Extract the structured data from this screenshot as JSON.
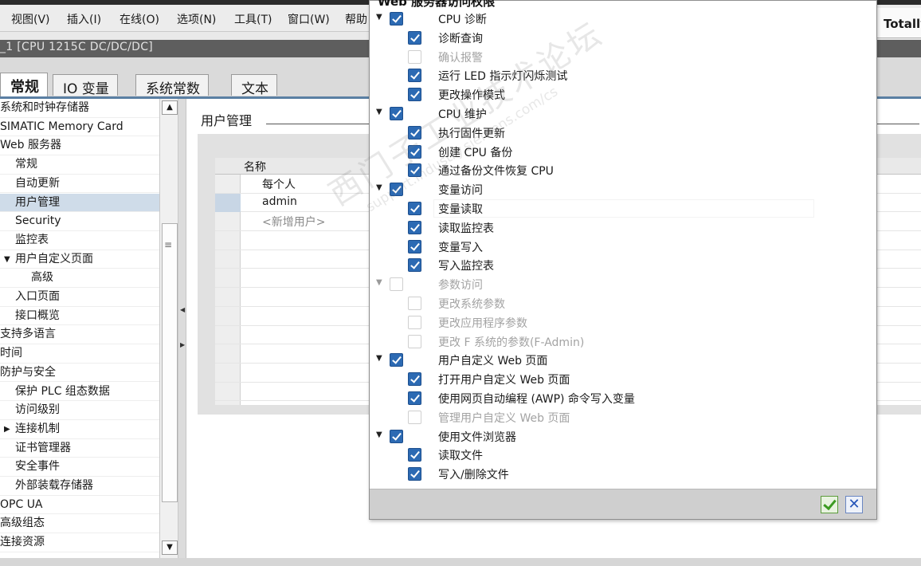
{
  "menubar": {
    "items": [
      "视图(V)",
      "插入(I)",
      "在线(O)",
      "选项(N)",
      "工具(T)",
      "窗口(W)",
      "帮助"
    ],
    "right_label": "Totally"
  },
  "title_bar": {
    "text": "_1 [CPU 1215C DC/DC/DC]"
  },
  "tabs": [
    {
      "label": "常规",
      "active": true
    },
    {
      "label": "IO 变量",
      "active": false
    },
    {
      "label": "系统常数",
      "active": false
    },
    {
      "label": "文本",
      "active": false
    }
  ],
  "sidebar": {
    "items": [
      {
        "label": "系统和时钟存储器",
        "indent": 0,
        "arrow": ""
      },
      {
        "label": "SIMATIC Memory Card",
        "indent": 0,
        "arrow": ""
      },
      {
        "label": "Web 服务器",
        "indent": 0,
        "arrow": ""
      },
      {
        "label": "常规",
        "indent": 1,
        "arrow": ""
      },
      {
        "label": "自动更新",
        "indent": 1,
        "arrow": ""
      },
      {
        "label": "用户管理",
        "indent": 1,
        "arrow": "",
        "selected": true
      },
      {
        "label": "Security",
        "indent": 1,
        "arrow": ""
      },
      {
        "label": "监控表",
        "indent": 1,
        "arrow": ""
      },
      {
        "label": "用户自定义页面",
        "indent": 1,
        "arrow": "▼"
      },
      {
        "label": "高级",
        "indent": 2,
        "arrow": ""
      },
      {
        "label": "入口页面",
        "indent": 1,
        "arrow": ""
      },
      {
        "label": "接口概览",
        "indent": 1,
        "arrow": ""
      },
      {
        "label": "支持多语言",
        "indent": 0,
        "arrow": ""
      },
      {
        "label": "时间",
        "indent": 0,
        "arrow": ""
      },
      {
        "label": "防护与安全",
        "indent": 0,
        "arrow": ""
      },
      {
        "label": "保护 PLC 组态数据",
        "indent": 1,
        "arrow": ""
      },
      {
        "label": "访问级别",
        "indent": 1,
        "arrow": ""
      },
      {
        "label": "连接机制",
        "indent": 1,
        "arrow": "▶"
      },
      {
        "label": "证书管理器",
        "indent": 1,
        "arrow": ""
      },
      {
        "label": "安全事件",
        "indent": 1,
        "arrow": ""
      },
      {
        "label": "外部装载存储器",
        "indent": 1,
        "arrow": ""
      },
      {
        "label": "OPC UA",
        "indent": 0,
        "arrow": ""
      },
      {
        "label": "高级组态",
        "indent": 0,
        "arrow": ""
      },
      {
        "label": "连接资源",
        "indent": 0,
        "arrow": ""
      }
    ]
  },
  "main": {
    "section_title": "用户管理",
    "table": {
      "header": "名称",
      "rows": [
        {
          "name": "每个人",
          "placeholder": false
        },
        {
          "name": "admin",
          "placeholder": false,
          "selected": true
        },
        {
          "name": "<新增用户>",
          "placeholder": true
        }
      ]
    }
  },
  "popup": {
    "title": "Web 服务器访问权限",
    "permissions": [
      {
        "label": "CPU 诊断",
        "level": 0,
        "checked": true,
        "enabled": true,
        "expander": true
      },
      {
        "label": "诊断查询",
        "level": 1,
        "checked": true,
        "enabled": true
      },
      {
        "label": "确认报警",
        "level": 1,
        "checked": false,
        "enabled": false
      },
      {
        "label": "运行 LED 指示灯闪烁测试",
        "level": 1,
        "checked": true,
        "enabled": true
      },
      {
        "label": "更改操作模式",
        "level": 1,
        "checked": true,
        "enabled": true
      },
      {
        "label": "CPU 维护",
        "level": 0,
        "checked": true,
        "enabled": true,
        "expander": true
      },
      {
        "label": "执行固件更新",
        "level": 1,
        "checked": true,
        "enabled": true
      },
      {
        "label": "创建 CPU 备份",
        "level": 1,
        "checked": true,
        "enabled": true
      },
      {
        "label": "通过备份文件恢复 CPU",
        "level": 1,
        "checked": true,
        "enabled": true
      },
      {
        "label": "变量访问",
        "level": 0,
        "checked": true,
        "enabled": true,
        "expander": true
      },
      {
        "label": "变量读取",
        "level": 1,
        "checked": true,
        "enabled": true,
        "highlight": true
      },
      {
        "label": "读取监控表",
        "level": 1,
        "checked": true,
        "enabled": true
      },
      {
        "label": "变量写入",
        "level": 1,
        "checked": true,
        "enabled": true
      },
      {
        "label": "写入监控表",
        "level": 1,
        "checked": true,
        "enabled": true
      },
      {
        "label": "参数访问",
        "level": 0,
        "checked": false,
        "enabled": false,
        "expander": true
      },
      {
        "label": "更改系统参数",
        "level": 1,
        "checked": false,
        "enabled": false
      },
      {
        "label": "更改应用程序参数",
        "level": 1,
        "checked": false,
        "enabled": false
      },
      {
        "label": "更改 F 系统的参数(F-Admin)",
        "level": 1,
        "checked": false,
        "enabled": false
      },
      {
        "label": "用户自定义 Web 页面",
        "level": 0,
        "checked": true,
        "enabled": true,
        "expander": true
      },
      {
        "label": "打开用户自定义 Web 页面",
        "level": 1,
        "checked": true,
        "enabled": true
      },
      {
        "label": "使用网页自动编程 (AWP) 命令写入变量",
        "level": 1,
        "checked": true,
        "enabled": true
      },
      {
        "label": "管理用户自定义 Web 页面",
        "level": 1,
        "checked": false,
        "enabled": false
      },
      {
        "label": "使用文件浏览器",
        "level": 0,
        "checked": true,
        "enabled": true,
        "expander": true
      },
      {
        "label": "读取文件",
        "level": 1,
        "checked": true,
        "enabled": true
      },
      {
        "label": "写入/删除文件",
        "level": 1,
        "checked": true,
        "enabled": true
      }
    ]
  },
  "watermark": {
    "line1": "西门子工业技术论坛",
    "line2": "support.industry.siemens.com/cs"
  },
  "colors": {
    "accent_blue": "#2c6ab3",
    "selection": "#cfdce9",
    "title_bar": "#5e5e5e",
    "ok_green": "#3c9b22",
    "cancel_blue": "#2554b8"
  }
}
